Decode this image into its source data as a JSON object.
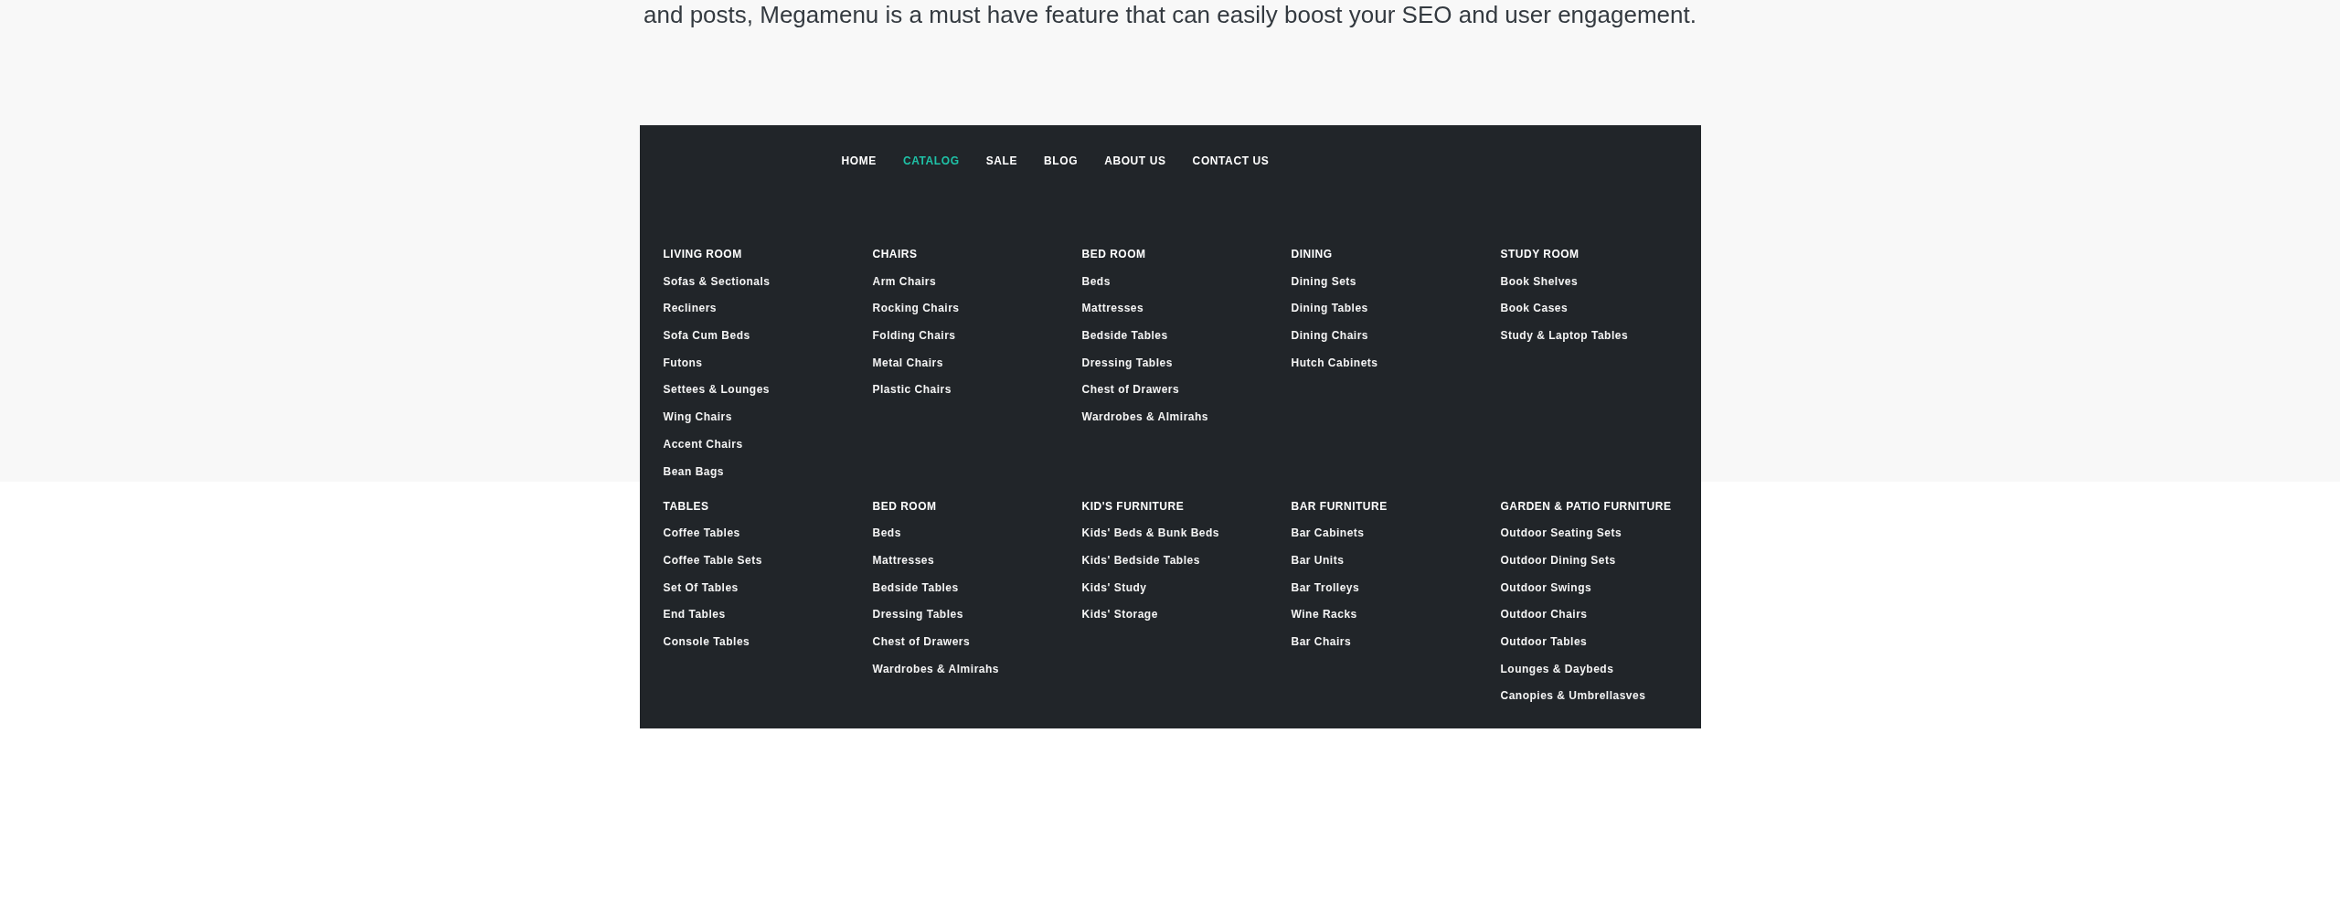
{
  "intro_text": "and posts, Megamenu is a must have feature that can easily boost your SEO and user engagement.",
  "nav": {
    "items": [
      {
        "label": "HOME",
        "selected": false
      },
      {
        "label": "CATALOG",
        "selected": true
      },
      {
        "label": "SALE",
        "selected": false
      },
      {
        "label": "BLOG",
        "selected": false
      },
      {
        "label": "ABOUT US",
        "selected": false
      },
      {
        "label": "CONTACT US",
        "selected": false
      }
    ]
  },
  "megamenu": {
    "rows": [
      {
        "columns": [
          {
            "heading": "LIVING ROOM",
            "items": [
              "Sofas & Sectionals",
              "Recliners",
              "Sofa Cum Beds",
              "Futons",
              "Settees & Lounges",
              "Wing Chairs",
              "Accent Chairs",
              "Bean Bags"
            ]
          },
          {
            "heading": "CHAIRS",
            "items": [
              "Arm Chairs",
              "Rocking Chairs",
              "Folding Chairs",
              "Metal Chairs",
              "Plastic Chairs"
            ]
          },
          {
            "heading": "BED ROOM",
            "items": [
              "Beds",
              "Mattresses",
              "Bedside Tables",
              "Dressing Tables",
              "Chest of Drawers",
              "Wardrobes & Almirahs"
            ]
          },
          {
            "heading": "DINING",
            "items": [
              "Dining Sets",
              "Dining Tables",
              "Dining Chairs",
              "Hutch Cabinets"
            ]
          },
          {
            "heading": "STUDY ROOM",
            "items": [
              "Book Shelves",
              "Book Cases",
              "Study & Laptop Tables"
            ]
          }
        ]
      },
      {
        "columns": [
          {
            "heading": "TABLES",
            "items": [
              "Coffee Tables",
              "Coffee Table Sets",
              "Set Of Tables",
              "End Tables",
              "Console Tables"
            ]
          },
          {
            "heading": "BED ROOM",
            "items": [
              "Beds",
              "Mattresses",
              "Bedside Tables",
              "Dressing Tables",
              "Chest of Drawers",
              "Wardrobes & Almirahs"
            ]
          },
          {
            "heading": "KID'S FURNITURE",
            "items": [
              "Kids' Beds & Bunk Beds",
              "Kids' Bedside Tables",
              "Kids' Study",
              "Kids' Storage"
            ]
          },
          {
            "heading": "BAR FURNITURE",
            "items": [
              "Bar Cabinets",
              "Bar Units",
              "Bar Trolleys",
              "Wine Racks",
              "Bar Chairs"
            ]
          },
          {
            "heading": "GARDEN & PATIO FURNITURE",
            "items": [
              "Outdoor Seating Sets",
              "Outdoor Dining Sets",
              "Outdoor Swings",
              "Outdoor Chairs",
              "Outdoor Tables",
              "Lounges & Daybeds",
              "Canopies & Umbrellasves"
            ]
          }
        ]
      }
    ]
  }
}
